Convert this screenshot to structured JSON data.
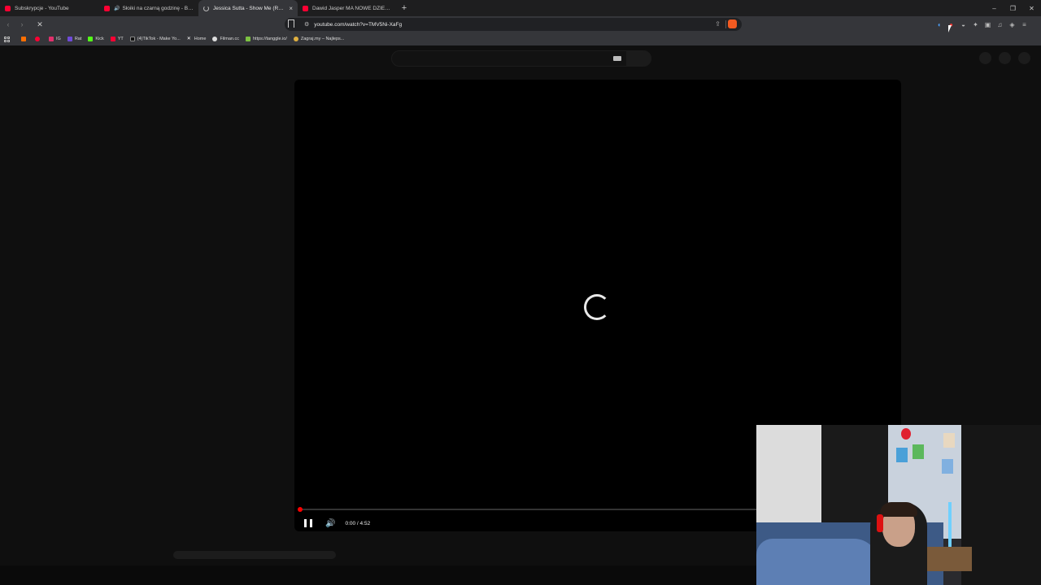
{
  "tabs": [
    {
      "title": "Subskrypcje - YouTube",
      "active": false,
      "audio": false
    },
    {
      "title": "Słoiki na czarną godzinę - Biała L...",
      "active": false,
      "audio": true
    },
    {
      "title": "Jessica Sutta - Show Me (Roma L...",
      "active": true,
      "audio": false
    },
    {
      "title": "Dawid Jasper MA NOWE DZIECKO, M...",
      "active": false,
      "audio": false
    }
  ],
  "new_tab_label": "+",
  "window_controls": {
    "minimize": "–",
    "restore": "❐",
    "close": "✕"
  },
  "toolbar": {
    "back": "‹",
    "forward": "›",
    "stop": "✕",
    "url": "youtube.com/watch?v=TMV5Ni-XaFg"
  },
  "bookmarks": [
    {
      "label": "",
      "color": "#ff6f00"
    },
    {
      "label": "",
      "color": "#ff0033"
    },
    {
      "label": "IG",
      "color": "#e1306c"
    },
    {
      "label": "Rat",
      "color": "#6f4bd8"
    },
    {
      "label": "Kick",
      "color": "#53fc18"
    },
    {
      "label": "YT",
      "color": "#ff0033"
    },
    {
      "label": "(4)TikTok - Make Yo...",
      "color": "#111111"
    },
    {
      "label": "Home",
      "color": "#ffffff"
    },
    {
      "label": "Filman.cc",
      "color": "#ffffff"
    },
    {
      "label": "https://tanggle.io/",
      "color": "#7cc242"
    },
    {
      "label": "Zagraj.my – Najleps...",
      "color": "#e0b040"
    }
  ],
  "player": {
    "current_time": "0:00",
    "separator": "/",
    "duration": "4:52",
    "progress": 0,
    "state": "loading"
  },
  "icons": {
    "pause": "pause-icon",
    "volume": "volume-icon",
    "spinner": "loading-spinner-icon"
  },
  "colors": {
    "accent": "#ff0000",
    "page_bg": "#0f0f0f",
    "chrome_bg": "#35363a"
  }
}
